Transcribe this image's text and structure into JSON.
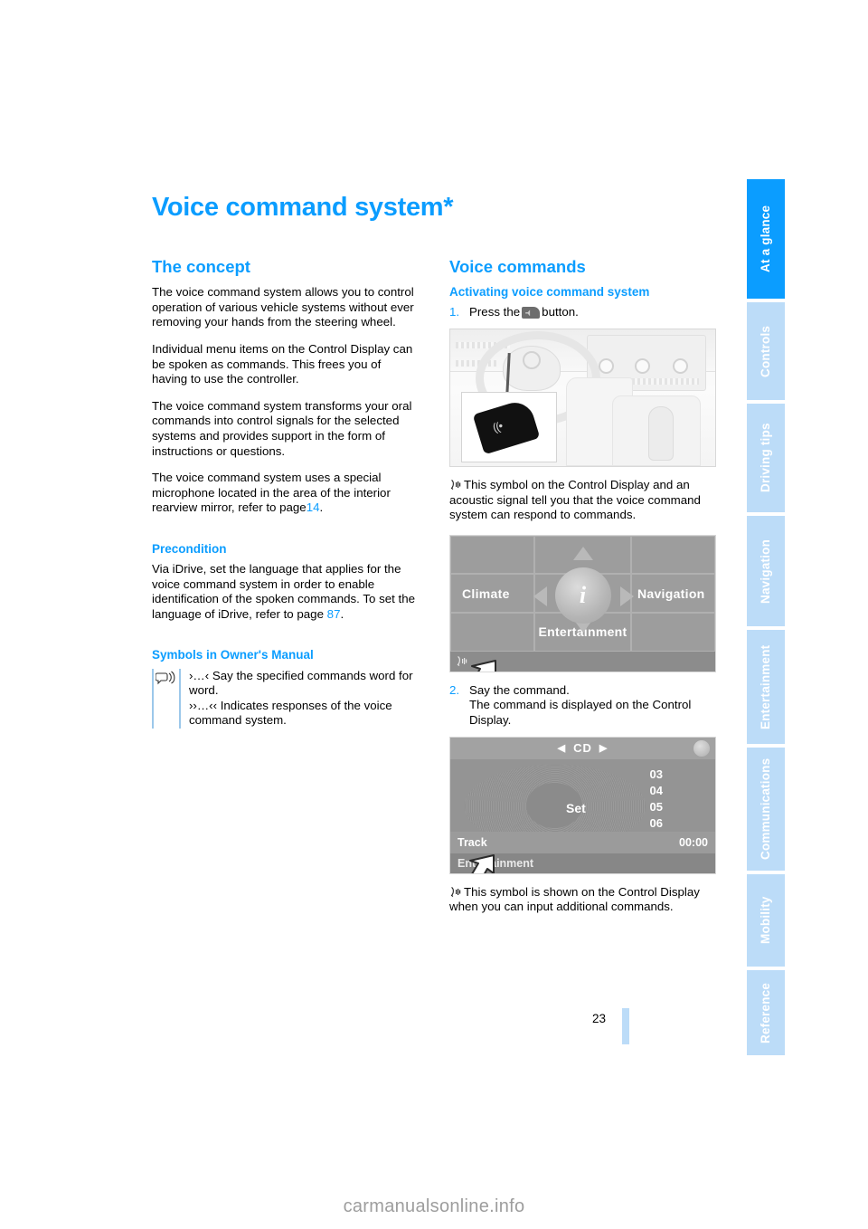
{
  "document": {
    "title": "Voice command system*",
    "page_number": "23",
    "watermark": "carmanualsonline.info"
  },
  "tabs": [
    {
      "label": "At a glance",
      "active": true
    },
    {
      "label": "Controls",
      "active": false
    },
    {
      "label": "Driving tips",
      "active": false
    },
    {
      "label": "Navigation",
      "active": false
    },
    {
      "label": "Entertainment",
      "active": false
    },
    {
      "label": "Communications",
      "active": false
    },
    {
      "label": "Mobility",
      "active": false
    },
    {
      "label": "Reference",
      "active": false
    }
  ],
  "left_column": {
    "concept": {
      "heading": "The concept",
      "paragraphs": [
        "The voice command system allows you to control operation of various vehicle systems without ever removing your hands from the steering wheel.",
        "Individual menu items on the Control Display can be spoken as commands. This frees you of having to use the controller.",
        "The voice command system transforms your oral commands into control signals for the selected systems and provides support in the form of instructions or questions."
      ],
      "paragraph_with_ref": {
        "text_before": "The voice command system uses a special microphone located in the area of the interior rearview mirror, refer to page",
        "page_ref": "14",
        "text_after": "."
      }
    },
    "precondition": {
      "heading": "Precondition",
      "text_before": "Via iDrive, set the language that applies for the voice command system in order to enable identification of the spoken commands. To set the language of iDrive, refer to page",
      "page_ref": "87",
      "text_after": "."
    },
    "symbols": {
      "heading": "Symbols in Owner's Manual",
      "icon_name": "speech-bubble-icon",
      "line1": "›…‹ Say the specified commands word for word.",
      "line2": "››…‹‹ Indicates responses of the voice command system."
    }
  },
  "right_column": {
    "heading": "Voice commands",
    "activating": {
      "heading": "Activating voice command system",
      "step1": {
        "number": "1.",
        "text_before": "Press the",
        "button_icon_name": "voice-command-button-icon",
        "text_after": "button."
      },
      "figure_cabin": {
        "name": "car-interior-figure",
        "inset_name": "voice-button-inset",
        "inset_glyph": "((•"
      },
      "caption1": {
        "symbol_name": "voice-ready-symbol",
        "text": "This symbol on the Control Display and an acoustic signal tell you that the voice command system can respond to commands."
      },
      "idrive_menu": {
        "name": "idrive-main-menu-figure",
        "center_glyph": "i",
        "items": [
          "Climate",
          "Navigation",
          "Entertainment"
        ],
        "status_bar_symbol": "voice-ready-symbol",
        "cursor_name": "pointer-arrow"
      },
      "step2": {
        "number": "2.",
        "line1": "Say the command.",
        "line2": "The command is displayed on the Control Display."
      },
      "cd_screen": {
        "name": "cd-player-figure",
        "header": "CD",
        "center_label": "Set",
        "track_list": [
          "03",
          "04",
          "05",
          "06"
        ],
        "track_label": "Track",
        "time": "00:00",
        "bottom_label": "Entertainment",
        "cursor_name": "pointer-arrow"
      },
      "caption2": {
        "symbol_name": "voice-additional-commands-symbol",
        "text": "This symbol is shown on the Control Display when you can input additional commands."
      }
    }
  },
  "colors": {
    "accent_blue": "#0b9dff",
    "tab_inactive": "#bcdcf8",
    "rule_blue": "#9cc8ea"
  }
}
